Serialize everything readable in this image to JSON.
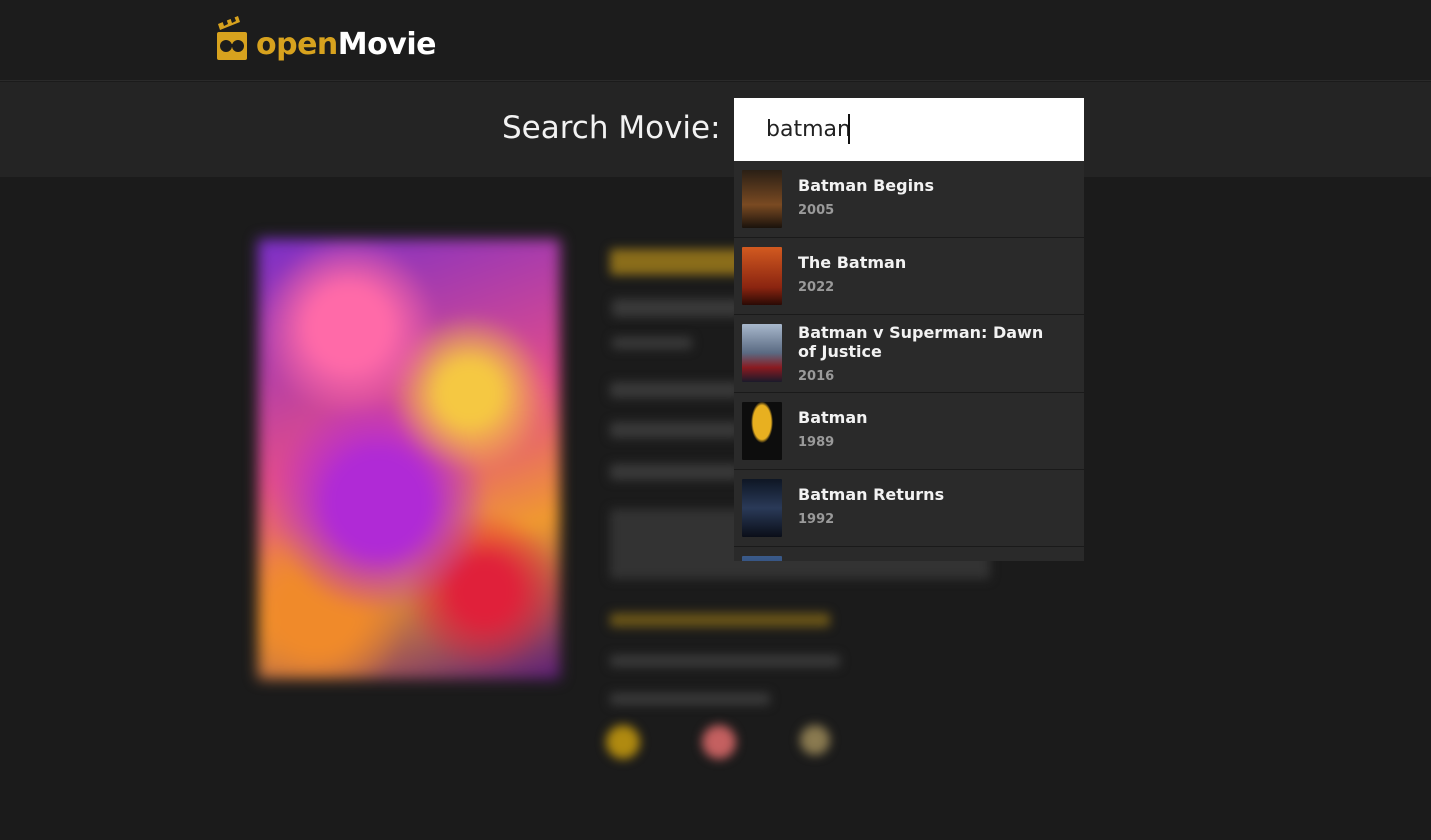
{
  "brand": {
    "name_part1": "open",
    "name_part2": "Movie",
    "accent": "#d7a21e"
  },
  "search": {
    "label": "Search Movie:",
    "value": "batman"
  },
  "results": [
    {
      "title": "Batman Begins",
      "year": "2005",
      "poster_color": "#5a3a24"
    },
    {
      "title": "The Batman",
      "year": "2022",
      "poster_color": "#b8441c"
    },
    {
      "title": "Batman v Superman: Dawn of Justice",
      "year": "2016",
      "poster_color": "#7b8ea8"
    },
    {
      "title": "Batman",
      "year": "1989",
      "poster_color": "#0d0d0d"
    },
    {
      "title": "Batman Returns",
      "year": "1992",
      "poster_color": "#1d2a3c"
    }
  ]
}
